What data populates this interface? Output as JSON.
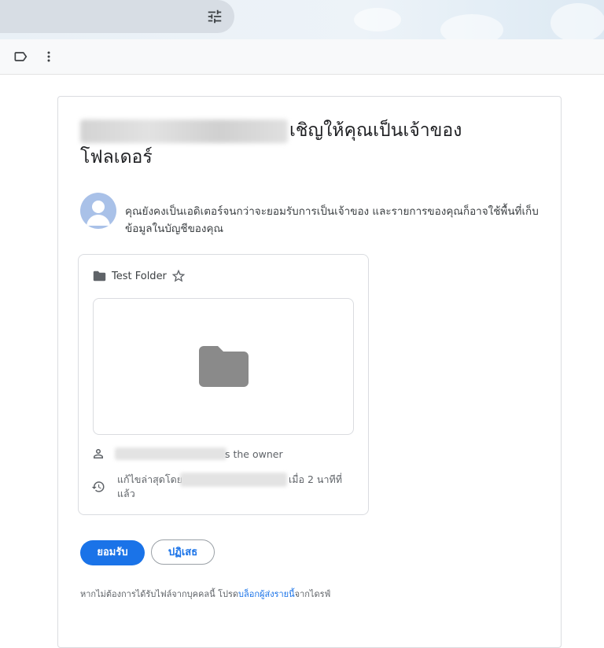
{
  "invite": {
    "title_line1": "เชิญให้คุณเป็นเจ้าของ",
    "title_line2": "โฟลเดอร์",
    "message": "คุณยังคงเป็นเอดิเตอร์จนกว่าจะยอมรับการเป็นเจ้าของ และรายการของคุณก็อาจใช้พื้นที่เก็บข้อมูลในบัญชีของคุณ"
  },
  "item": {
    "name": "Test Folder",
    "owner_suffix": "s the owner",
    "modified_prefix": "แก้ไขล่าสุดโดย",
    "modified_suffix": "เมื่อ 2 นาทีที่",
    "modified_line2": "แล้ว"
  },
  "actions": {
    "accept_label": "ยอมรับ",
    "decline_label": "ปฏิเสธ"
  },
  "footer": {
    "prefix": "หากไม่ต้องการได้รับไฟล์จากบุคคลนี้ โปรด",
    "link": "บล็อกผู้ส่งรายนี้",
    "suffix": "จากไดรฟ์"
  },
  "icons": {
    "top_filter": "tune-icon",
    "label": "label-icon",
    "more": "more-vert-icon",
    "folder": "folder-icon",
    "star": "star-outline-icon",
    "person": "person-icon",
    "history": "history-icon"
  },
  "colors": {
    "accent": "#1a73e8",
    "folder_gray": "#8a8a8a",
    "avatar_bg": "#a9c1e8"
  }
}
